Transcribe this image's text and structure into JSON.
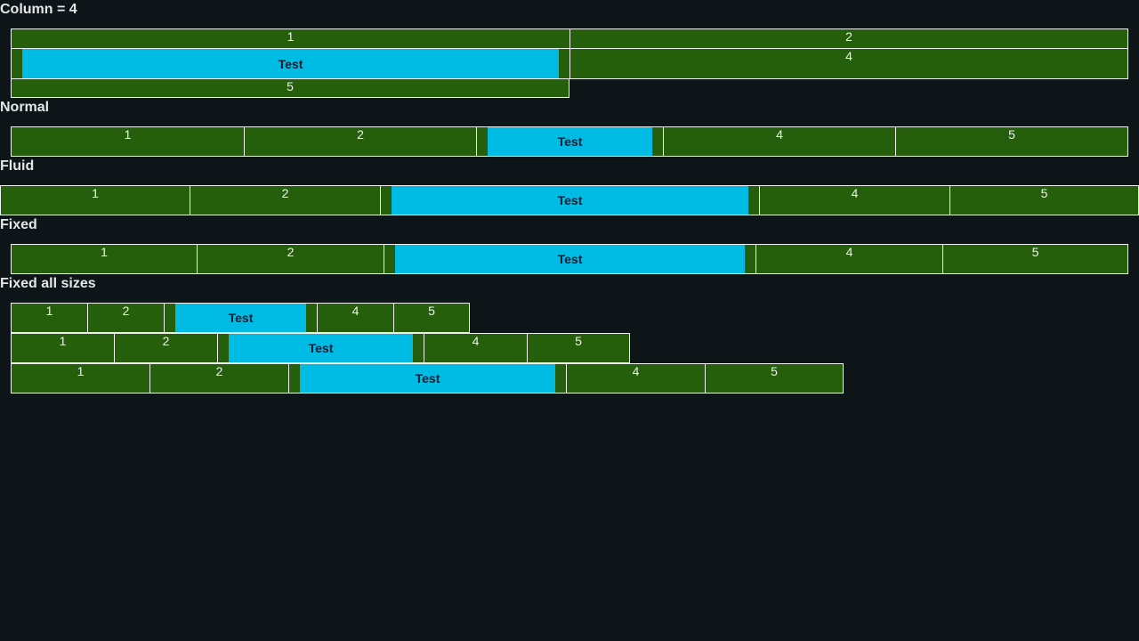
{
  "sections": {
    "column4": {
      "title": "Column = 4"
    },
    "normal": {
      "title": "Normal"
    },
    "fluid": {
      "title": "Fluid"
    },
    "fixed": {
      "title": "Fixed"
    },
    "fixed_all_sizes": {
      "title": "Fixed all sizes"
    }
  },
  "cells": {
    "one": "1",
    "two": "2",
    "four": "4",
    "five": "5",
    "test": "Test"
  },
  "colors": {
    "background": "#0e1519",
    "cell": "#265f0c",
    "highlight": "#00bce5",
    "border": "#f2f2f2"
  }
}
